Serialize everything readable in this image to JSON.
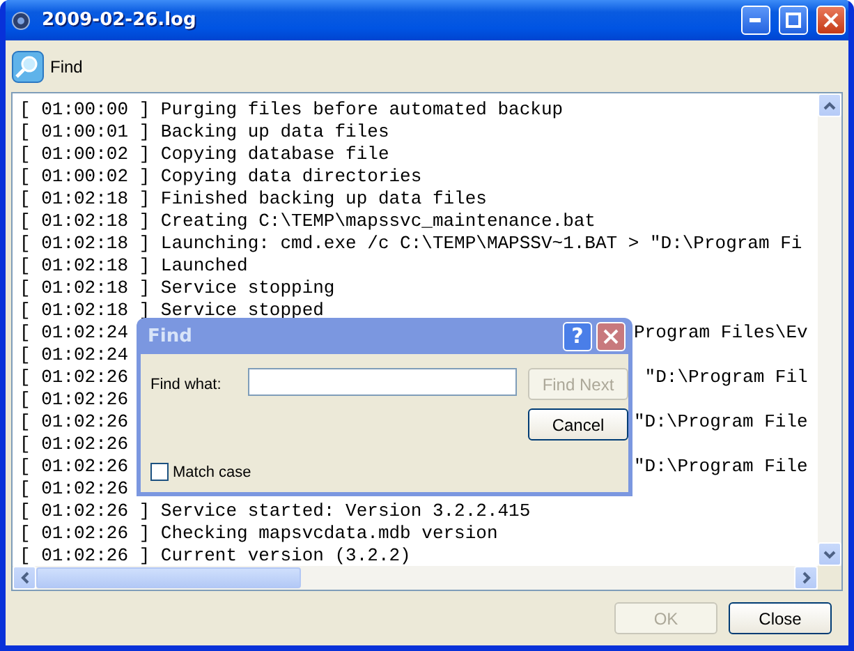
{
  "window": {
    "title": "2009-02-26.log"
  },
  "toolbar": {
    "find_label": "Find"
  },
  "log_lines": [
    {
      "text": "[ 01:00:00 ] Purging files before automated backup"
    },
    {
      "text": "[ 01:00:01 ] Backing up data files"
    },
    {
      "text": "[ 01:00:02 ] Copying database file"
    },
    {
      "text": "[ 01:00:02 ] Copying data directories"
    },
    {
      "text": "[ 01:02:18 ] Finished backing up data files"
    },
    {
      "text": "[ 01:02:18 ] Creating C:\\TEMP\\mapssvc_maintenance.bat"
    },
    {
      "text": "[ 01:02:18 ] Launching: cmd.exe /c C:\\TEMP\\MAPSSV~1.BAT > \"D:\\Program Fi"
    },
    {
      "text": "[ 01:02:18 ] Launched"
    },
    {
      "text": "[ 01:02:18 ] Service stopping"
    },
    {
      "text": "[ 01:02:18 ] Service stopped"
    },
    {
      "text": "[ 01:02:24",
      "tail": "Program Files\\Ev"
    },
    {
      "text": "[ 01:02:24"
    },
    {
      "text": "[ 01:02:26",
      "tail": " \"D:\\Program Fil"
    },
    {
      "text": "[ 01:02:26"
    },
    {
      "text": "[ 01:02:26",
      "tail": "\"D:\\Program File"
    },
    {
      "text": "[ 01:02:26"
    },
    {
      "text": "[ 01:02:26",
      "tail": "\"D:\\Program File"
    },
    {
      "text": "[ 01:02:26"
    },
    {
      "text": "[ 01:02:26 ] Service started: Version 3.2.2.415"
    },
    {
      "text": "[ 01:02:26 ] Checking mapsvcdata.mdb version"
    },
    {
      "text": "[ 01:02:26 ] Current version (3.2.2)"
    }
  ],
  "find_dialog": {
    "title": "Find",
    "help": "?",
    "find_what_label": "Find what:",
    "find_next": {
      "label": "Find Next",
      "disabled": true
    },
    "cancel": {
      "label": "Cancel",
      "disabled": false
    },
    "match_case": {
      "label": "Match case",
      "checked": false
    }
  },
  "buttons": [
    {
      "label": "OK",
      "disabled": true
    },
    {
      "label": "Close",
      "disabled": false
    }
  ]
}
